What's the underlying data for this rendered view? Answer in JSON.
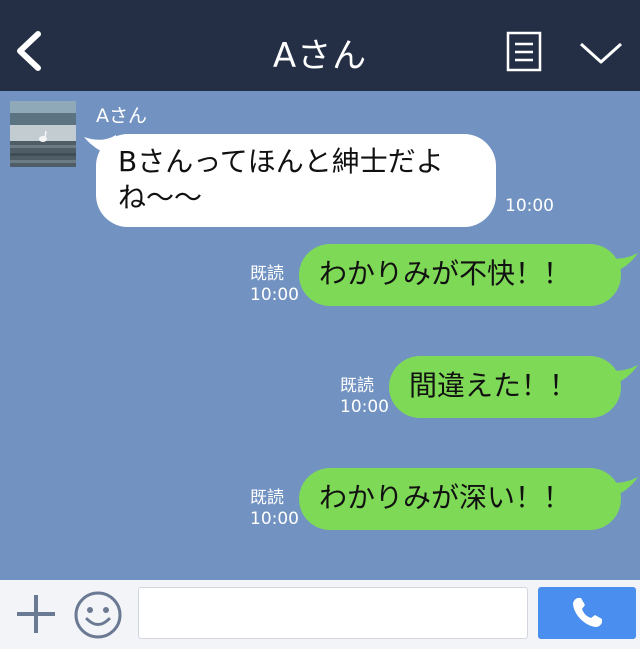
{
  "header": {
    "title": "Aさん",
    "back_icon": "chevron-left-icon",
    "menu_icon": "note-icon",
    "expand_icon": "chevron-down-icon",
    "background": "#242f45"
  },
  "chat": {
    "background": "#7293c2",
    "incoming": {
      "sender": "Aさん",
      "text": "Bさんってほんと紳士だよね〜〜",
      "time": "10:00",
      "bubble_color": "#ffffff"
    },
    "outgoing": [
      {
        "read": "既読",
        "time": "10:00",
        "text": "わかりみが不快！！"
      },
      {
        "read": "既読",
        "time": "10:00",
        "text": "間違えた！！"
      },
      {
        "read": "既読",
        "time": "10:00",
        "text": "わかりみが深い！！"
      }
    ],
    "outgoing_bubble_color": "#7ed957"
  },
  "footer": {
    "plus_icon": "plus-icon",
    "emoji_icon": "smiley-icon",
    "input_value": "",
    "call_icon": "phone-icon",
    "call_color": "#4a8ef0"
  }
}
